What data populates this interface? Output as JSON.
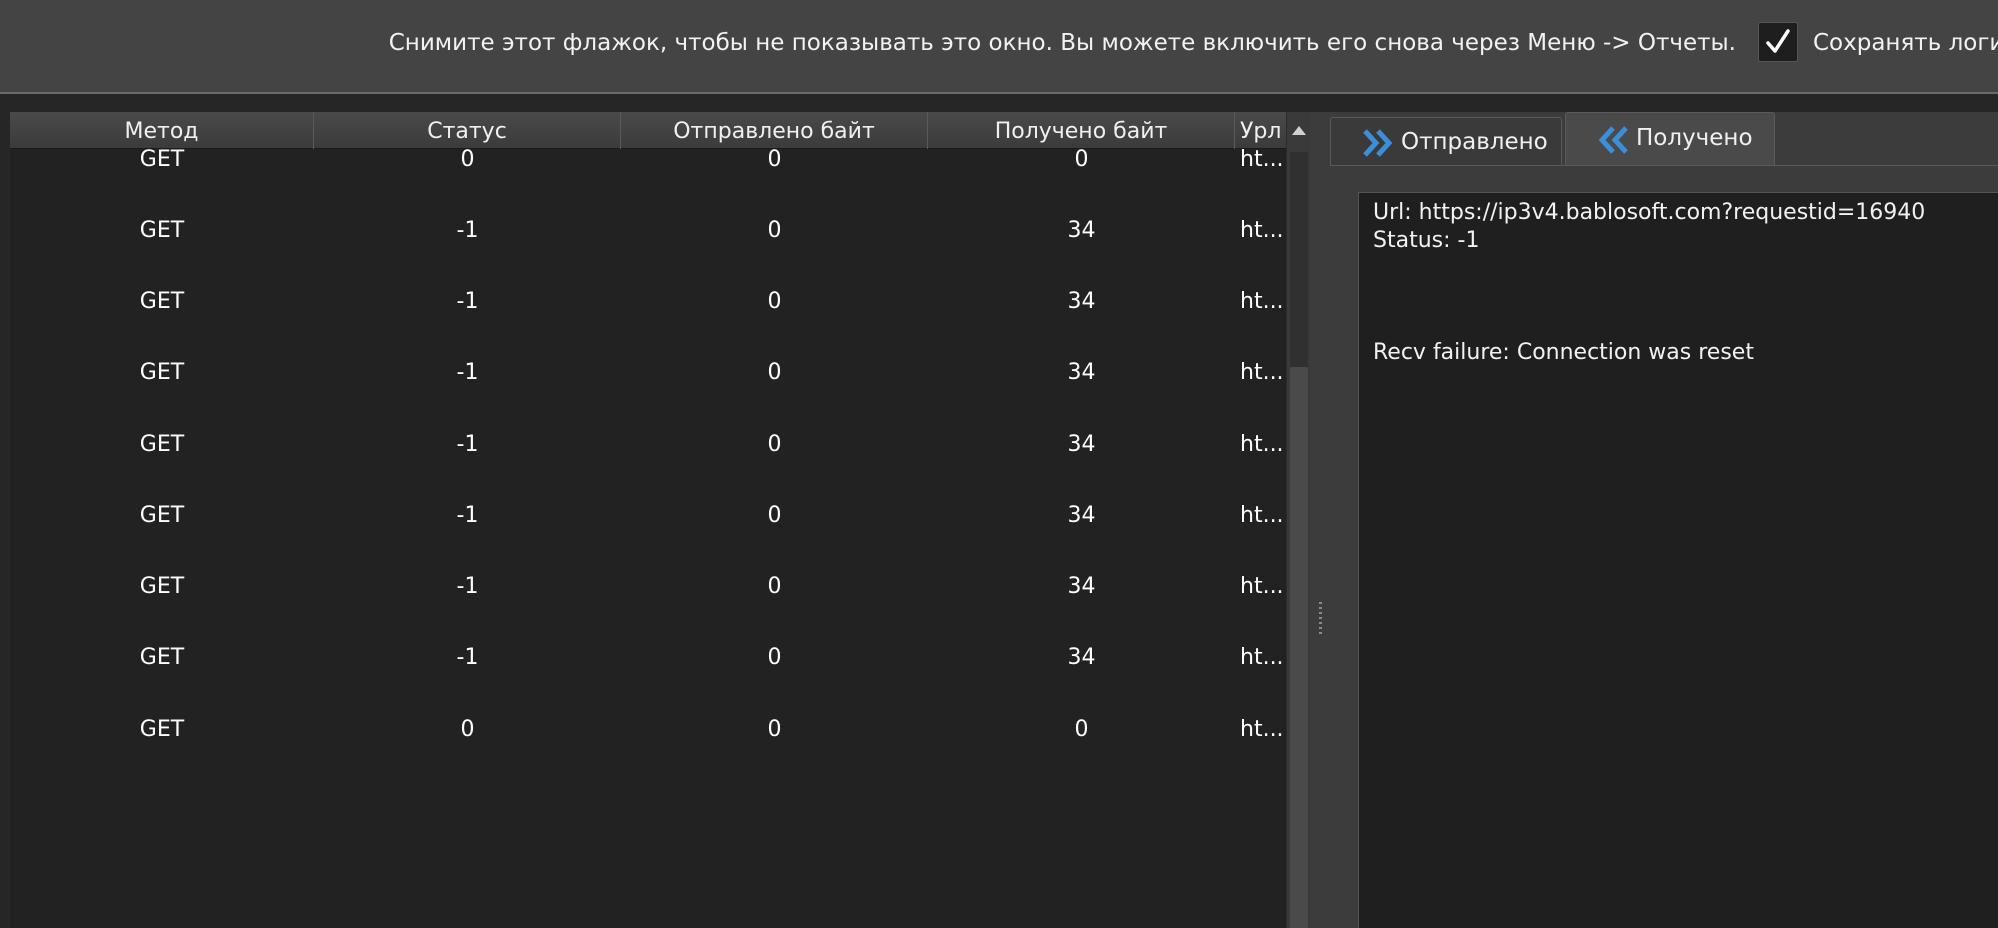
{
  "topbar": {
    "notice": "Снимите этот флажок, чтобы не показывать это окно. Вы можете включить его снова через Меню -> Отчеты.",
    "save_logs_label": "Сохранять логи",
    "save_logs_checked": true
  },
  "table": {
    "columns": [
      "Метод",
      "Статус",
      "Отправлено байт",
      "Получено байт",
      "Урл"
    ],
    "rows": [
      {
        "method": "GET",
        "status": "0",
        "sent": "0",
        "received": "0",
        "url": "ht..."
      },
      {
        "method": "GET",
        "status": "-1",
        "sent": "0",
        "received": "34",
        "url": "ht..."
      },
      {
        "method": "GET",
        "status": "-1",
        "sent": "0",
        "received": "34",
        "url": "ht..."
      },
      {
        "method": "GET",
        "status": "-1",
        "sent": "0",
        "received": "34",
        "url": "ht..."
      },
      {
        "method": "GET",
        "status": "-1",
        "sent": "0",
        "received": "34",
        "url": "ht..."
      },
      {
        "method": "GET",
        "status": "-1",
        "sent": "0",
        "received": "34",
        "url": "ht..."
      },
      {
        "method": "GET",
        "status": "-1",
        "sent": "0",
        "received": "34",
        "url": "ht..."
      },
      {
        "method": "GET",
        "status": "-1",
        "sent": "0",
        "received": "34",
        "url": "ht..."
      },
      {
        "method": "GET",
        "status": "0",
        "sent": "0",
        "received": "0",
        "url": "ht..."
      }
    ]
  },
  "tabs": {
    "sent_label": "Отправлено",
    "received_label": "Получено",
    "active": "received",
    "icon_color": "#3a8fd8"
  },
  "details": {
    "url_line": "Url: https://ip3v4.bablosoft.com?requestid=16940",
    "status_line": "Status: -1",
    "error_line": "Recv failure: Connection was reset"
  }
}
